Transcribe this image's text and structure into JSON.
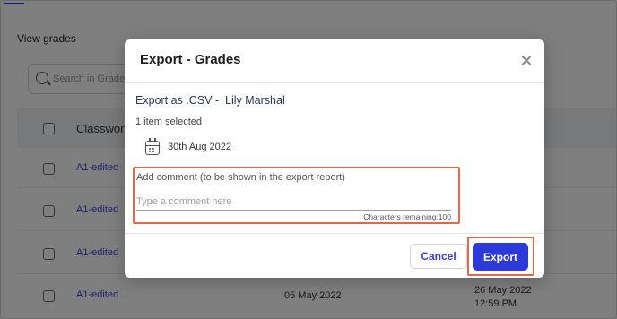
{
  "background": {
    "heading": "View grades",
    "search_placeholder": "Search in Grades",
    "table": {
      "first_column_header": "Classwork",
      "rows": [
        {
          "title": "A1-edited",
          "date_1": "",
          "date_2": ""
        },
        {
          "title": "A1-edited",
          "date_1": "",
          "date_2": ""
        },
        {
          "title": "A1-edited",
          "date_1": "",
          "date_2": ""
        },
        {
          "title": "A1-edited",
          "date_1": "05 May 2022",
          "date_2": "26 May 2022",
          "date_2_sub": "12:59 PM"
        }
      ]
    }
  },
  "modal": {
    "title": "Export - Grades",
    "export_as": "Export as .CSV -  Lily Marshal",
    "selected_count": "1 item selected",
    "date": "30th Aug 2022",
    "comment_label": "Add comment (to be shown in the export report)",
    "comment_placeholder": "Type a comment here",
    "chars_remaining": "Characters remaining:100",
    "cancel_label": "Cancel",
    "export_label": "Export"
  },
  "colors": {
    "accent": "#2d3adb",
    "link": "#3a3fd1",
    "highlight": "#e2694a"
  }
}
